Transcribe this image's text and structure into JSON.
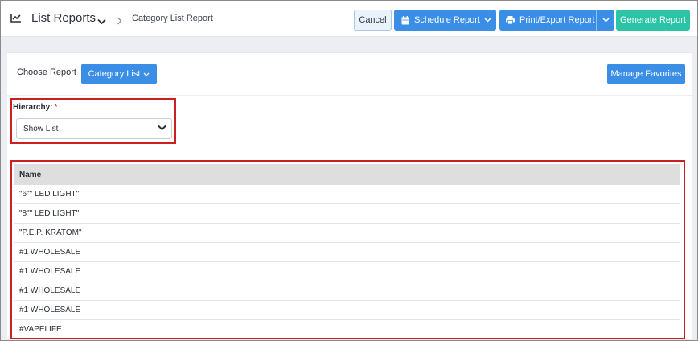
{
  "header": {
    "app_title": "List Reports",
    "breadcrumb": "Category List Report",
    "cancel_label": "Cancel",
    "schedule_label": "Schedule Report",
    "print_label": "Print/Export Report",
    "generate_label": "Generate Report"
  },
  "toolbar": {
    "choose_label": "Choose Report",
    "category_label": "Category List",
    "favorites_label": "Manage Favorites"
  },
  "filter": {
    "hierarchy_label": "Hierarchy:",
    "required_mark": "*",
    "hierarchy_value": "Show List"
  },
  "table": {
    "header": "Name",
    "rows": [
      "\"6\"\" LED LIGHT\"",
      "\"8\"\" LED LIGHT\"",
      "\"P.E.P. KRATOM\"",
      "#1 WHOLESALE",
      "#1 WHOLESALE",
      "#1 WHOLESALE",
      "#1 WHOLESALE",
      "#VAPELIFE"
    ]
  },
  "colors": {
    "primary": "#3a8ee6",
    "generate": "#2cc4a6",
    "highlight": "#cc1f1f"
  }
}
